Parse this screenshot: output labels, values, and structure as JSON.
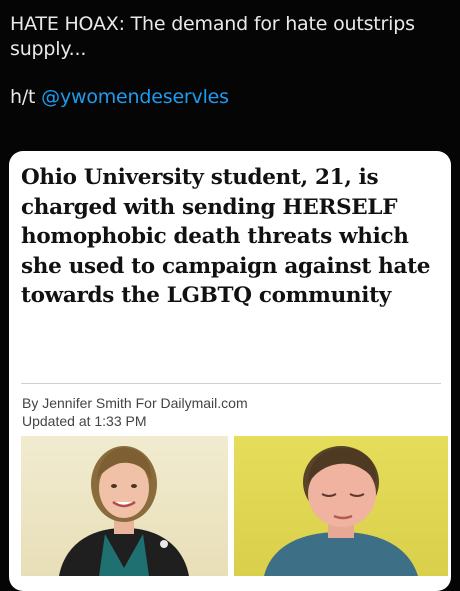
{
  "tweet": {
    "line1": "HATE HOAX: The demand for hate outstrips supply...",
    "hat_tip_prefix": "h/t ",
    "mention": "@ywomendeservles"
  },
  "article": {
    "headline": "Ohio University student, 21, is charged with sending HERSELF homophobic death threats which she used to campaign against hate towards the LGBTQ community",
    "byline": "By Jennifer Smith For Dailymail.com",
    "updated": "Updated at 1:33 PM"
  },
  "colors": {
    "background": "#050505",
    "tweet_text": "#e7e9ea",
    "mention": "#1d9bf0",
    "card": "#ffffff"
  }
}
